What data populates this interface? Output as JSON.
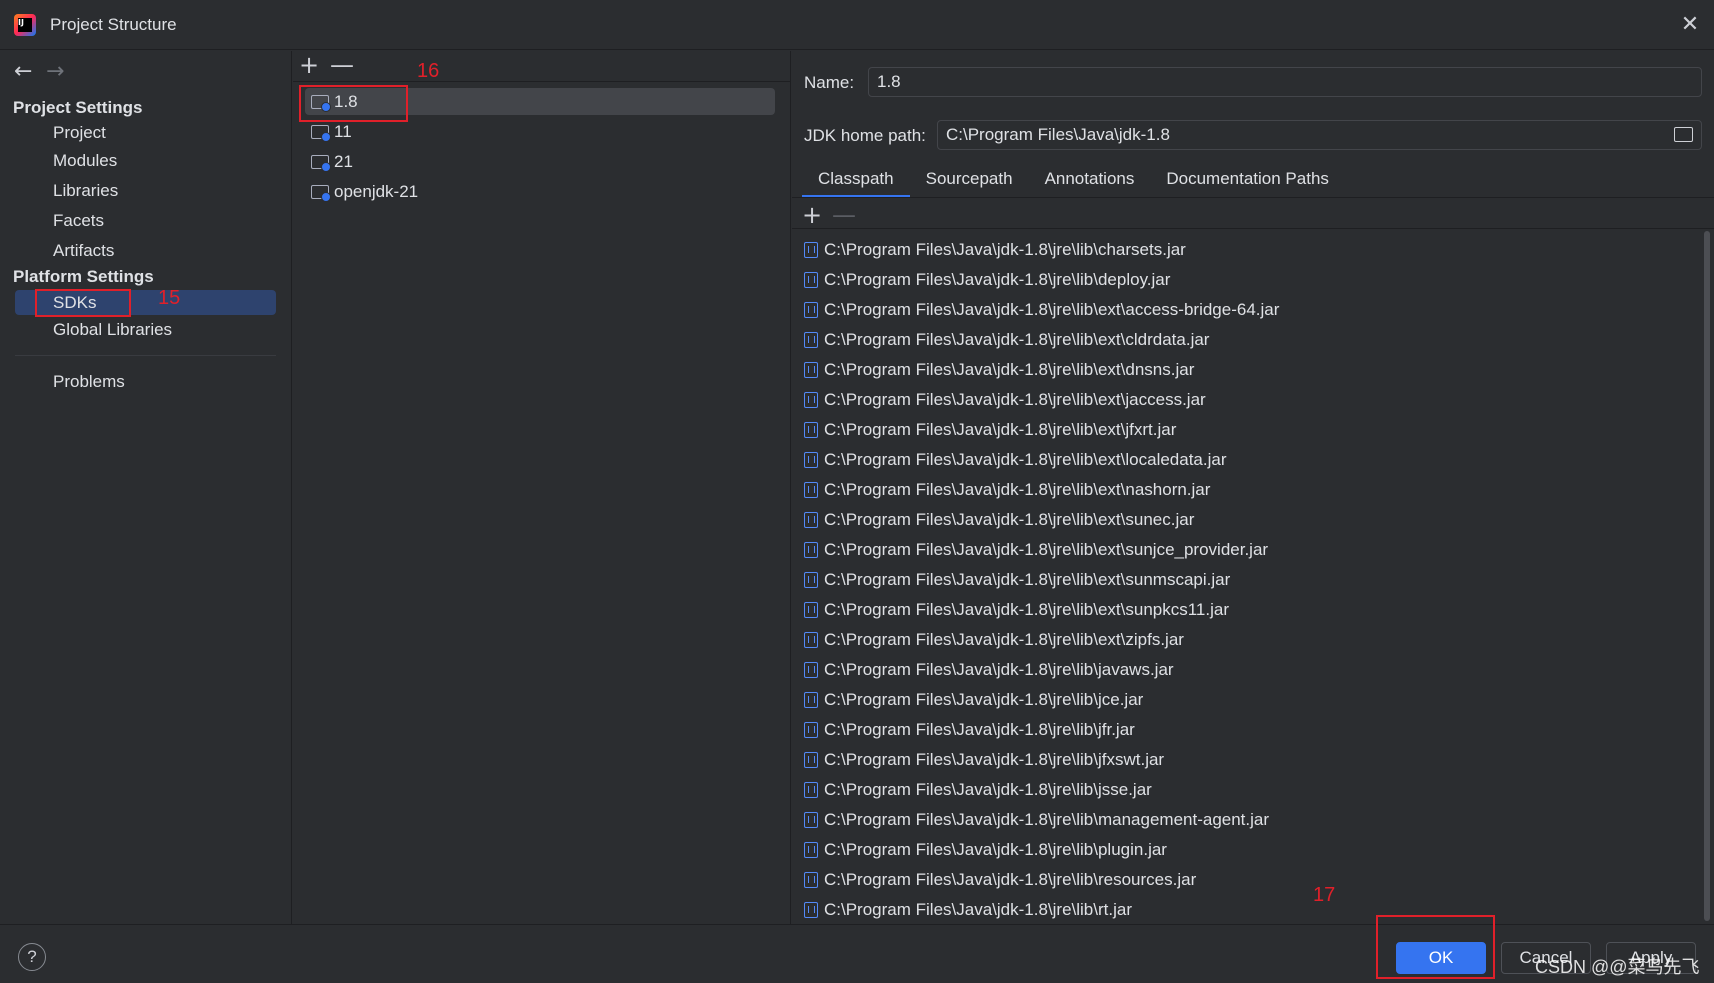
{
  "window": {
    "title": "Project Structure"
  },
  "nav": {
    "project_settings_label": "Project Settings",
    "project_items": [
      "Project",
      "Modules",
      "Libraries",
      "Facets",
      "Artifacts"
    ],
    "platform_settings_label": "Platform Settings",
    "platform_items": [
      "SDKs",
      "Global Libraries"
    ],
    "selected": "SDKs",
    "problems_label": "Problems"
  },
  "sdk_list": {
    "add_label": "+",
    "remove_label": "—",
    "items": [
      "1.8",
      "11",
      "21",
      "openjdk-21"
    ],
    "selected": "1.8"
  },
  "details": {
    "name_label": "Name:",
    "name_value": "1.8",
    "jdk_home_label": "JDK home path:",
    "jdk_home_value": "C:\\Program Files\\Java\\jdk-1.8",
    "tabs": [
      "Classpath",
      "Sourcepath",
      "Annotations",
      "Documentation Paths"
    ],
    "active_tab": "Classpath",
    "classpath": [
      "C:\\Program Files\\Java\\jdk-1.8\\jre\\lib\\charsets.jar",
      "C:\\Program Files\\Java\\jdk-1.8\\jre\\lib\\deploy.jar",
      "C:\\Program Files\\Java\\jdk-1.8\\jre\\lib\\ext\\access-bridge-64.jar",
      "C:\\Program Files\\Java\\jdk-1.8\\jre\\lib\\ext\\cldrdata.jar",
      "C:\\Program Files\\Java\\jdk-1.8\\jre\\lib\\ext\\dnsns.jar",
      "C:\\Program Files\\Java\\jdk-1.8\\jre\\lib\\ext\\jaccess.jar",
      "C:\\Program Files\\Java\\jdk-1.8\\jre\\lib\\ext\\jfxrt.jar",
      "C:\\Program Files\\Java\\jdk-1.8\\jre\\lib\\ext\\localedata.jar",
      "C:\\Program Files\\Java\\jdk-1.8\\jre\\lib\\ext\\nashorn.jar",
      "C:\\Program Files\\Java\\jdk-1.8\\jre\\lib\\ext\\sunec.jar",
      "C:\\Program Files\\Java\\jdk-1.8\\jre\\lib\\ext\\sunjce_provider.jar",
      "C:\\Program Files\\Java\\jdk-1.8\\jre\\lib\\ext\\sunmscapi.jar",
      "C:\\Program Files\\Java\\jdk-1.8\\jre\\lib\\ext\\sunpkcs11.jar",
      "C:\\Program Files\\Java\\jdk-1.8\\jre\\lib\\ext\\zipfs.jar",
      "C:\\Program Files\\Java\\jdk-1.8\\jre\\lib\\javaws.jar",
      "C:\\Program Files\\Java\\jdk-1.8\\jre\\lib\\jce.jar",
      "C:\\Program Files\\Java\\jdk-1.8\\jre\\lib\\jfr.jar",
      "C:\\Program Files\\Java\\jdk-1.8\\jre\\lib\\jfxswt.jar",
      "C:\\Program Files\\Java\\jdk-1.8\\jre\\lib\\jsse.jar",
      "C:\\Program Files\\Java\\jdk-1.8\\jre\\lib\\management-agent.jar",
      "C:\\Program Files\\Java\\jdk-1.8\\jre\\lib\\plugin.jar",
      "C:\\Program Files\\Java\\jdk-1.8\\jre\\lib\\resources.jar",
      "C:\\Program Files\\Java\\jdk-1.8\\jre\\lib\\rt.jar"
    ]
  },
  "footer": {
    "help_label": "?",
    "ok_label": "OK",
    "cancel_label": "Cancel",
    "apply_label": "Apply",
    "watermark": "CSDN @@菜鸟先飞"
  },
  "annotations": {
    "step15": "15",
    "step16": "16",
    "step17": "17"
  },
  "colors": {
    "accent": "#3574f0",
    "background": "#2b2d30",
    "highlight": "#e0202a",
    "nav_selection": "#2e436e"
  }
}
